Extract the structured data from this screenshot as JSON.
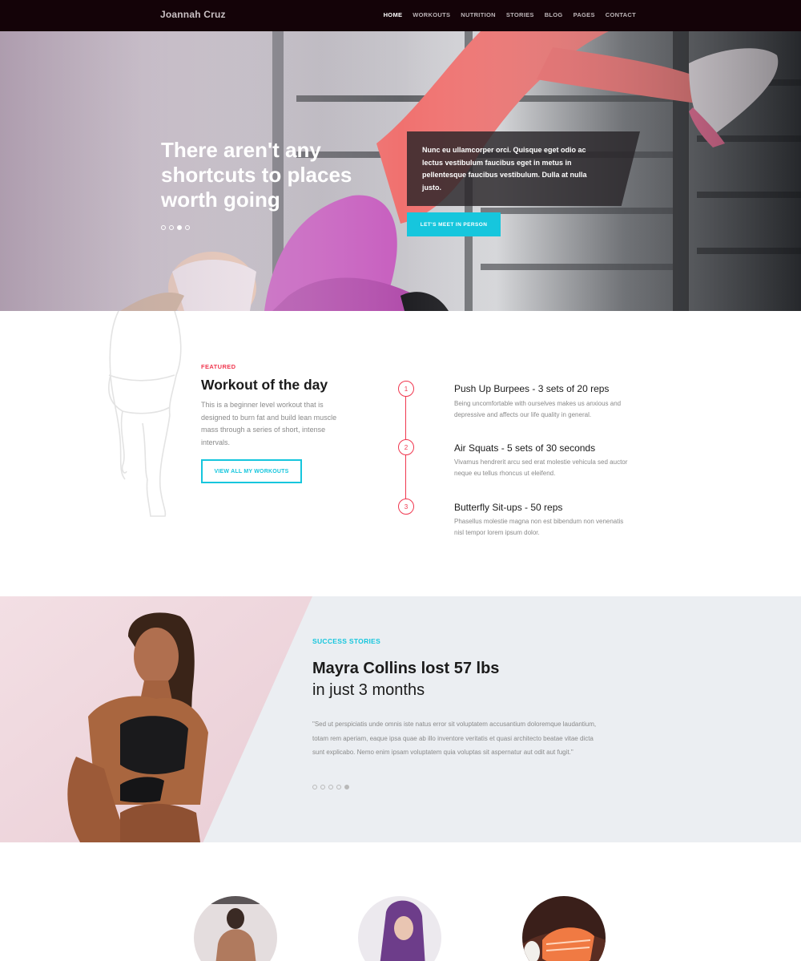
{
  "nav": {
    "brand": "Joannah Cruz",
    "items": [
      "HOME",
      "WORKOUTS",
      "NUTRITION",
      "STORIES",
      "BLOG",
      "PAGES",
      "CONTACT"
    ],
    "active_index": 0
  },
  "hero": {
    "title": "There aren't any shortcuts to places worth going",
    "text": "Nunc eu ullamcorper orci. Quisque eget odio ac lectus vestibulum faucibus eget in metus in pellentesque faucibus vestibulum. Dulla at nulla justo.",
    "cta": "LET'S MEET IN PERSON",
    "slide_count": 4,
    "active_slide": 3
  },
  "workout": {
    "label": "FEATURED",
    "title": "Workout of the day",
    "description": "This is a beginner level workout that is designed to burn fat and build lean muscle mass through a series of short, intense intervals.",
    "button": "VIEW ALL MY WORKOUTS",
    "steps": [
      {
        "num": "1",
        "title": "Push Up Burpees - 3 sets of 20 reps",
        "desc": "Being uncomfortable with ourselves makes us anxious and depressive and affects our life quality in general."
      },
      {
        "num": "2",
        "title": "Air Squats - 5 sets of 30 seconds",
        "desc": "Vivamus hendrerit arcu sed erat molestie vehicula sed auctor neque eu tellus rhoncus ut eleifend."
      },
      {
        "num": "3",
        "title": "Butterfly Sit-ups - 50 reps",
        "desc": "Phasellus molestie magna non est bibendum non venenatis nisl tempor lorem ipsum dolor."
      }
    ]
  },
  "success": {
    "label": "SUCCESS STORIES",
    "title": "Mayra Collins lost 57 lbs",
    "subtitle": "in just 3 months",
    "quote": "\"Sed ut perspiciatis unde omnis iste natus error sit voluptatem accusantium doloremque laudantium, totam rem aperiam, eaque ipsa quae ab illo inventore veritatis et quasi architecto beatae vitae dicta sunt explicabo. Nemo enim ipsam voluptatem quia voluptas sit aspernatur aut odit aut fugit.\"",
    "slide_count": 5,
    "active_slide": 5
  },
  "colors": {
    "accent_cyan": "#16c6dd",
    "accent_red": "#f0374f",
    "nav_bg": "#140308"
  }
}
